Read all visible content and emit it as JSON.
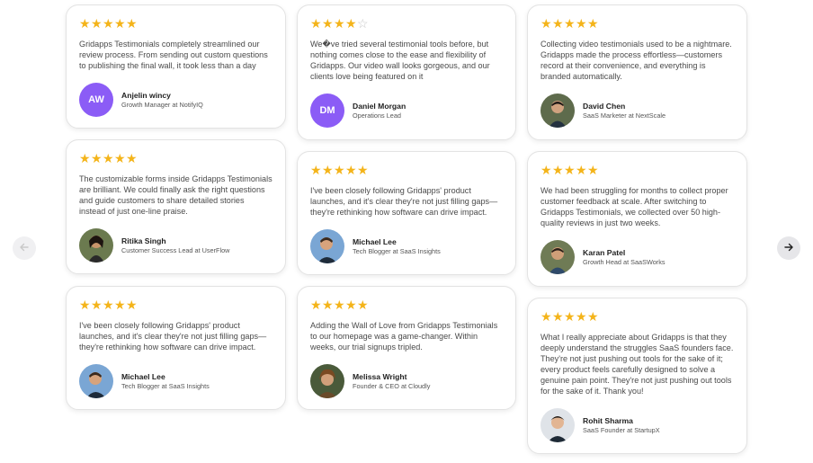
{
  "colors": {
    "star": "#f4b41a",
    "star_empty": "#c8c8c8",
    "initials_bg": "#8b5cf6"
  },
  "carousel": {
    "prev_icon": "arrow-left-icon",
    "next_icon": "arrow-right-icon"
  },
  "reviews": [
    {
      "rating": 5,
      "text": "Gridapps Testimonials completely streamlined our review process. From sending out custom questions to publishing the final wall, it took less than a day",
      "name": "Anjelin wincy",
      "role": "Growth Manager at NotifyIQ",
      "initials": "AW"
    },
    {
      "rating": 5,
      "text": "The customizable forms inside Gridapps Testimonials are brilliant. We could finally ask the right questions and guide customers to share detailed stories instead of just one-line praise.",
      "name": "Ritika Singh",
      "role": "Customer Success Lead at UserFlow",
      "initials": ""
    },
    {
      "rating": 5,
      "text": "I've been closely following Gridapps' product launches, and it's clear they're not just filling gaps—they're rethinking how software can drive impact.",
      "name": "Michael Lee",
      "role": "Tech Blogger at SaaS Insights",
      "initials": ""
    },
    {
      "rating": 4,
      "text": "We�ve tried several testimonial tools before, but nothing comes close to the ease and flexibility of Gridapps. Our video wall looks gorgeous, and our clients love being featured on it",
      "name": "Daniel Morgan",
      "role": "Operations Lead",
      "initials": "DM"
    },
    {
      "rating": 5,
      "text": "I've been closely following Gridapps' product launches, and it's clear they're not just filling gaps—they're rethinking how software can drive impact.",
      "name": "Michael Lee",
      "role": "Tech Blogger at SaaS Insights",
      "initials": ""
    },
    {
      "rating": 5,
      "text": "Adding the Wall of Love from Gridapps Testimonials to our homepage was a game-changer. Within weeks, our trial signups tripled.",
      "name": "Melissa Wright",
      "role": "Founder & CEO at Cloudly",
      "initials": ""
    },
    {
      "rating": 5,
      "text": "Collecting video testimonials used to be a nightmare. Gridapps made the process effortless—customers record at their convenience, and everything is branded automatically.",
      "name": "David Chen",
      "role": "SaaS Marketer at NextScale",
      "initials": ""
    },
    {
      "rating": 5,
      "text": "We had been struggling for months to collect proper customer feedback at scale. After switching to Gridapps Testimonials, we collected over 50 high-quality reviews in just two weeks.",
      "name": "Karan Patel",
      "role": "Growth Head at SaaSWorks",
      "initials": ""
    },
    {
      "rating": 5,
      "text": "What I really appreciate about Gridapps is that they deeply understand the struggles SaaS founders face. They're not just pushing out tools for the sake of it; every product feels carefully designed to solve a genuine pain point. They're not just pushing out tools for the sake of it. Thank you!",
      "name": "Rohit Sharma",
      "role": "SaaS Founder at StartupX",
      "initials": ""
    }
  ]
}
